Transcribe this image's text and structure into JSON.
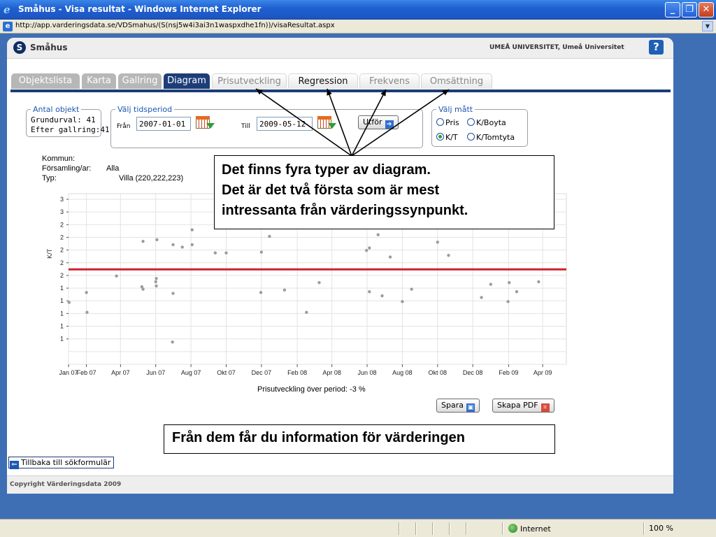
{
  "window": {
    "title": "Småhus - Visa resultat - Windows Internet Explorer",
    "url": "http://app.varderingsdata.se/VDSmahus/(S(nsj5w4i3ai3n1waspxdhe1fn))/visaResultat.aspx"
  },
  "app": {
    "title": "Småhus",
    "university": "UMEÅ UNIVERSITET, Umeå Universitet",
    "help_label": "?"
  },
  "tabs": [
    {
      "label": "Objektslista"
    },
    {
      "label": "Karta"
    },
    {
      "label": "Gallring"
    },
    {
      "label": "Diagram"
    },
    {
      "label": "Prisutveckling"
    },
    {
      "label": "Regression"
    },
    {
      "label": "Frekvens"
    },
    {
      "label": "Omsättning"
    }
  ],
  "antal": {
    "legend": "Antal objekt",
    "line1": "Grundurval:  41",
    "line2": "Efter gallring:41"
  },
  "period": {
    "legend": "Välj tidsperiod",
    "from_label": "Från",
    "from_value": "2007-01-01",
    "to_label": "Till",
    "to_value": "2009-05-12",
    "run_label": "Utför"
  },
  "measure": {
    "legend": "Välj mått",
    "options": [
      {
        "label": "Pris",
        "selected": false
      },
      {
        "label": "K/Boyta",
        "selected": false
      },
      {
        "label": "K/T",
        "selected": true
      },
      {
        "label": "K/Tomtyta",
        "selected": false
      }
    ]
  },
  "info": {
    "kommun_label": "Kommun:",
    "kommun_value": "",
    "forsamling_label": "Församling/ar:",
    "forsamling_value": "Alla",
    "typ_label": "Typ:",
    "typ_value": "Villa (220,222,223)"
  },
  "chart_data": {
    "type": "scatter",
    "ylabel": "K/T",
    "xlabel": "",
    "xlim": [
      "2007-01-01",
      "2009-05-12"
    ],
    "x_ticks": [
      "Jan 07",
      "Feb 07",
      "Apr 07",
      "Jun 07",
      "Aug 07",
      "Okt 07",
      "Dec 07",
      "Feb 08",
      "Apr 08",
      "Jun 08",
      "Aug 08",
      "Okt 08",
      "Dec 08",
      "Feb 09",
      "Apr 09"
    ],
    "x_tick_dates": [
      "2007-01-01",
      "2007-02-01",
      "2007-04-01",
      "2007-06-01",
      "2007-08-01",
      "2007-10-01",
      "2007-12-01",
      "2008-02-01",
      "2008-04-01",
      "2008-06-01",
      "2008-08-01",
      "2008-10-01",
      "2008-12-01",
      "2009-02-01",
      "2009-04-01"
    ],
    "y_ticks": [
      "3",
      "3",
      "2",
      "2",
      "2",
      "2",
      "2",
      "1",
      "1",
      "1",
      "1",
      "1"
    ],
    "grid": true,
    "mean_line": {
      "y": 2.0,
      "color": "#d0202e"
    },
    "points_color": "#9c9c9c",
    "points": [
      {
        "x": "2007-01-02",
        "y": 1.6
      },
      {
        "x": "2007-02-01",
        "y": 1.72
      },
      {
        "x": "2007-02-02",
        "y": 1.48
      },
      {
        "x": "2007-03-25",
        "y": 1.92
      },
      {
        "x": "2007-05-10",
        "y": 2.34
      },
      {
        "x": "2007-05-08",
        "y": 1.79
      },
      {
        "x": "2007-05-10",
        "y": 1.76
      },
      {
        "x": "2007-06-01",
        "y": 1.85
      },
      {
        "x": "2007-06-02",
        "y": 1.89
      },
      {
        "x": "2007-06-02",
        "y": 1.8
      },
      {
        "x": "2007-06-03",
        "y": 2.36
      },
      {
        "x": "2007-06-30",
        "y": 1.12
      },
      {
        "x": "2007-07-01",
        "y": 2.3
      },
      {
        "x": "2007-07-01",
        "y": 1.71
      },
      {
        "x": "2007-07-17",
        "y": 2.27
      },
      {
        "x": "2007-08-03",
        "y": 2.48
      },
      {
        "x": "2007-08-03",
        "y": 2.3
      },
      {
        "x": "2007-09-12",
        "y": 2.2
      },
      {
        "x": "2007-10-01",
        "y": 2.2
      },
      {
        "x": "2007-12-01",
        "y": 2.21
      },
      {
        "x": "2007-11-30",
        "y": 1.72
      },
      {
        "x": "2007-12-15",
        "y": 2.4
      },
      {
        "x": "2008-01-10",
        "y": 1.75
      },
      {
        "x": "2008-02-17",
        "y": 1.48
      },
      {
        "x": "2008-03-10",
        "y": 1.84
      },
      {
        "x": "2008-05-31",
        "y": 2.23
      },
      {
        "x": "2008-06-05",
        "y": 2.26
      },
      {
        "x": "2008-06-05",
        "y": 1.73
      },
      {
        "x": "2008-06-20",
        "y": 2.42
      },
      {
        "x": "2008-06-27",
        "y": 1.68
      },
      {
        "x": "2008-07-11",
        "y": 2.15
      },
      {
        "x": "2008-08-01",
        "y": 1.61
      },
      {
        "x": "2008-08-17",
        "y": 1.76
      },
      {
        "x": "2008-10-01",
        "y": 2.33
      },
      {
        "x": "2008-10-20",
        "y": 2.17
      },
      {
        "x": "2008-12-16",
        "y": 1.66
      },
      {
        "x": "2009-01-01",
        "y": 1.82
      },
      {
        "x": "2009-01-31",
        "y": 1.61
      },
      {
        "x": "2009-02-02",
        "y": 1.84
      },
      {
        "x": "2009-02-15",
        "y": 1.73
      },
      {
        "x": "2009-03-25",
        "y": 1.85
      }
    ]
  },
  "chart_caption": "Prisutveckling över period: -3 %",
  "actions": {
    "save_label": "Spara",
    "pdf_label": "Skapa PDF"
  },
  "callouts": {
    "top_lines": [
      "Det finns fyra typer av diagram.",
      "Det är det två första som är mest",
      "intressanta från värderingssynpunkt."
    ],
    "bottom": "Från dem får du information för värderingen"
  },
  "back_label": "Tillbaka till sökformulär",
  "footer": "Copyright Värderingsdata 2009",
  "statusbar": {
    "zone": "Internet",
    "zoom": "100 %"
  }
}
